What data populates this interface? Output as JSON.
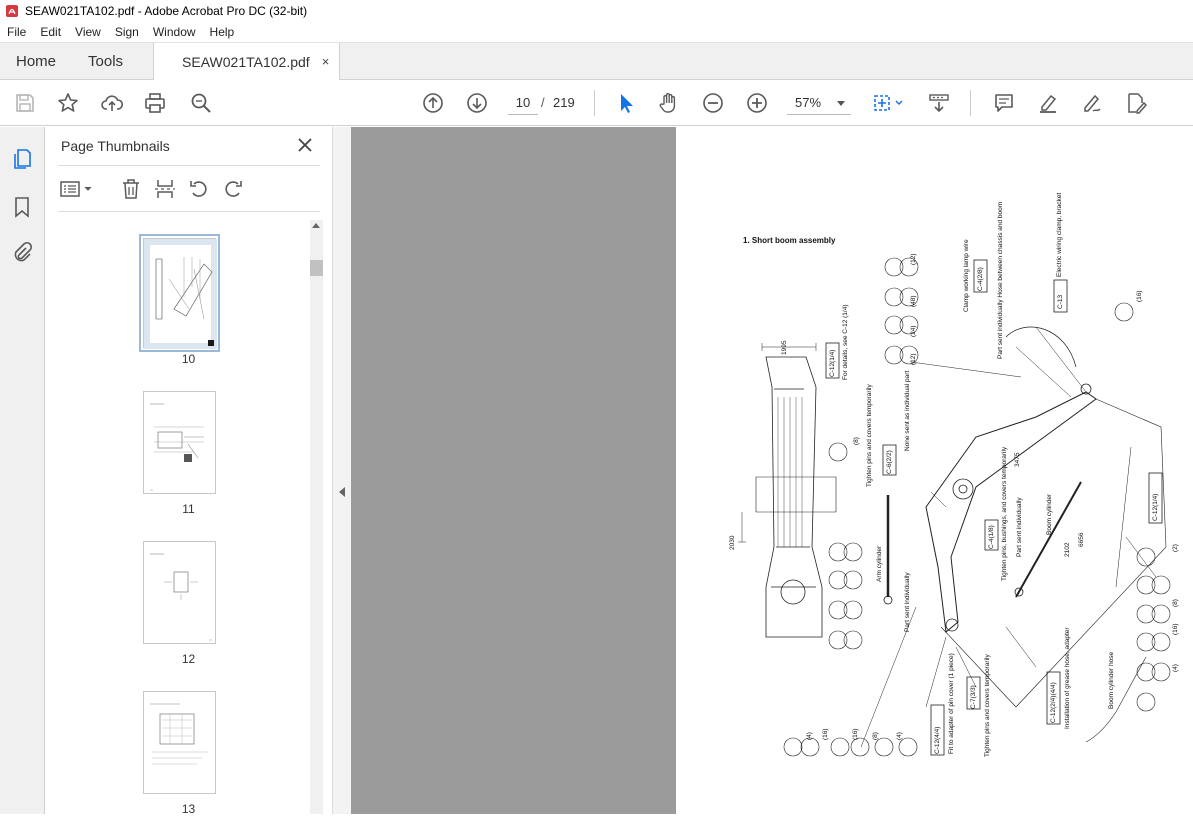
{
  "window": {
    "title": "SEAW021TA102.pdf - Adobe Acrobat Pro DC (32-bit)"
  },
  "menu": [
    "File",
    "Edit",
    "View",
    "Sign",
    "Window",
    "Help"
  ],
  "tabs": {
    "home": "Home",
    "tools": "Tools",
    "document": "SEAW021TA102.pdf",
    "close_glyph": "×"
  },
  "toolbar": {
    "current_page": "10",
    "separator": "/",
    "total_pages": "219",
    "zoom": "57%",
    "icons": [
      "save-icon",
      "bookmark-star-icon",
      "upload-icon",
      "print-icon",
      "search-zoom-icon",
      "page-up-icon",
      "page-down-icon",
      "select-arrow-icon",
      "hand-icon",
      "zoom-out-icon",
      "zoom-in-icon",
      "marquee-icon",
      "scroll-mode-icon",
      "comment-icon",
      "highlight-icon",
      "fill-sign-icon",
      "edit-pdf-icon"
    ]
  },
  "thumbnails_pane": {
    "title": "Page Thumbnails",
    "pages": [
      {
        "label": "10",
        "selected": true
      },
      {
        "label": "11",
        "selected": false
      },
      {
        "label": "12",
        "selected": false
      },
      {
        "label": "13",
        "selected": false
      }
    ]
  },
  "document": {
    "section_title": "1. Short boom assembly",
    "labels": {
      "clamp_working": "Clamp working lamp wire",
      "ref_c4_2": "C-4(2/8)",
      "part_sent_hose": "Part sent individually Hose between chassis and boom",
      "ref_c13": "C-13",
      "electric_wiring": "Electric wiring clamp, bracket",
      "ref_c12_1_4": "C-12(1/4)",
      "for_details": "For details, see C-12 (1/4)",
      "dim_1995": "1995",
      "dim_2030": "2030",
      "tighten_pins": "Tighten pins and covers temporarily",
      "ref_c6_2": "C-6(2/2)",
      "none_sent": "None sent as individual part",
      "arm_cylinder": "Arm cylinder",
      "part_sent_ind": "Part sent individually",
      "ref_c4_1": "C-4(1/8)",
      "tighten_pins_bushings": "Tighten pins, bushings, and covers temporarily",
      "part_sent_ind2": "Part sent individually",
      "boom_cylinder": "Boom cylinder",
      "dim_3475": "3475",
      "dim_2102": "2102",
      "dim_6656": "6656",
      "ref_c12_1_4b": "C-12(1/4)",
      "ref_c12_4_4": "C-12(4/4)",
      "fit_adapter": "Fit to adapter of pin cover (1 piece)",
      "ref_c7_3": "C-7(3/3)",
      "tighten_pins3": "Tighten pins and covers temporarily",
      "ref_c12_2_4": "C-12(2/4)(4/4)",
      "install_grease": "Installation of grease hose, adapter",
      "boom_cylinder_hose": "Boom cylinder hose",
      "qty_12": "(12)",
      "qty_48": "(48)",
      "qty_24": "(24)",
      "qty_16": "(16)",
      "qty_8": "(8)",
      "qty_4": "(4)",
      "qty_2": "(2)"
    }
  },
  "colors": {
    "accent_blue": "#1473e6",
    "icon_gray": "#5a5a5a",
    "doc_bg": "#9b9b9b",
    "pdf_red": "#d7373f"
  }
}
